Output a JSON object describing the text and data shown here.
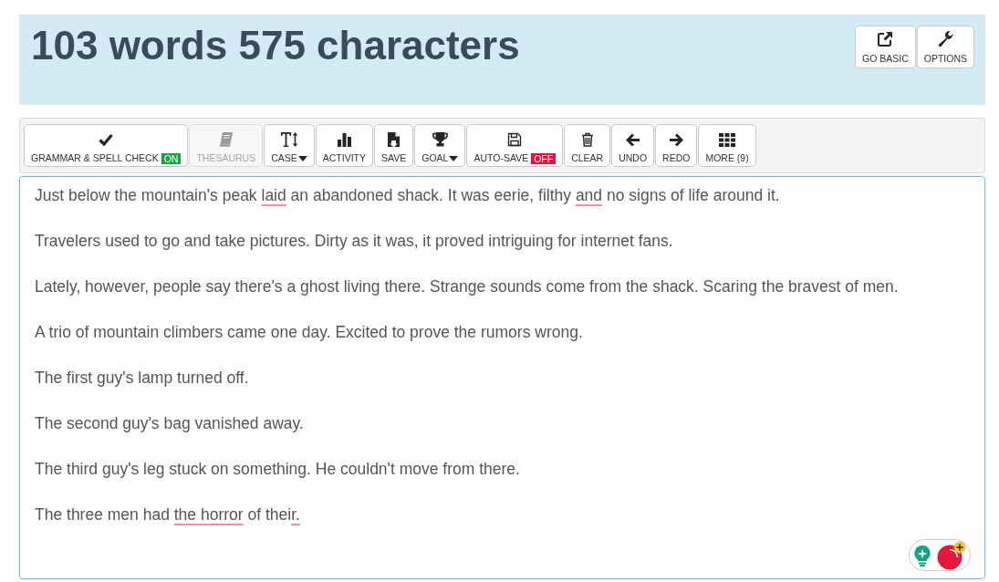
{
  "header": {
    "title": "103 words 575 characters",
    "buttons": [
      {
        "label": "GO BASIC"
      },
      {
        "label": "OPTIONS"
      }
    ]
  },
  "toolbar": {
    "buttons": [
      {
        "label": "GRAMMAR & SPELL CHECK",
        "kind": "toggle",
        "badge": "ON",
        "on": true,
        "disabled": false
      },
      {
        "label": "THESAURUS",
        "kind": "button",
        "disabled": true
      },
      {
        "label": "CASE",
        "kind": "dropdown",
        "disabled": false
      },
      {
        "label": "ACTIVITY",
        "kind": "button",
        "disabled": false
      },
      {
        "label": "SAVE",
        "kind": "button",
        "disabled": false
      },
      {
        "label": "GOAL",
        "kind": "dropdown",
        "disabled": false
      },
      {
        "label": "AUTO-SAVE",
        "kind": "toggle",
        "badge": "OFF",
        "on": false,
        "disabled": false
      },
      {
        "label": "CLEAR",
        "kind": "button",
        "disabled": false
      },
      {
        "label": "UNDO",
        "kind": "button",
        "disabled": false
      },
      {
        "label": "REDO",
        "kind": "button",
        "disabled": false
      },
      {
        "label": "MORE (9)",
        "kind": "button",
        "disabled": false
      }
    ]
  },
  "editor": {
    "paragraphs": [
      {
        "segments": [
          {
            "text": "Just below the mountain's peak ",
            "flagged": false
          },
          {
            "text": "laid",
            "flagged": true
          },
          {
            "text": " an abandoned shack. It was eerie, filthy ",
            "flagged": false
          },
          {
            "text": "and",
            "flagged": true
          },
          {
            "text": " no signs of life around it.",
            "flagged": false
          }
        ]
      },
      {
        "segments": [
          {
            "text": "Travelers used to go and take pictures. Dirty as it was, it proved intriguing for internet fans.",
            "flagged": false
          }
        ]
      },
      {
        "segments": [
          {
            "text": "Lately, however, people say there's a ghost living there. Strange sounds come from the shack. Scaring the bravest of men.",
            "flagged": false
          }
        ]
      },
      {
        "segments": [
          {
            "text": "A trio of mountain climbers came one day. Excited to prove the rumors wrong.",
            "flagged": false
          }
        ]
      },
      {
        "segments": [
          {
            "text": "The first guy's lamp turned off.",
            "flagged": false
          }
        ]
      },
      {
        "segments": [
          {
            "text": "The second guy's bag vanished away.",
            "flagged": false
          }
        ]
      },
      {
        "segments": [
          {
            "text": "The third guy's leg stuck on something. He couldn't move from there.",
            "flagged": false
          }
        ]
      },
      {
        "segments": [
          {
            "text": "The three men had ",
            "flagged": false
          },
          {
            "text": "the horror",
            "flagged": true
          },
          {
            "text": " of thei",
            "flagged": false
          },
          {
            "text": "r.",
            "flagged": true
          }
        ]
      }
    ]
  }
}
